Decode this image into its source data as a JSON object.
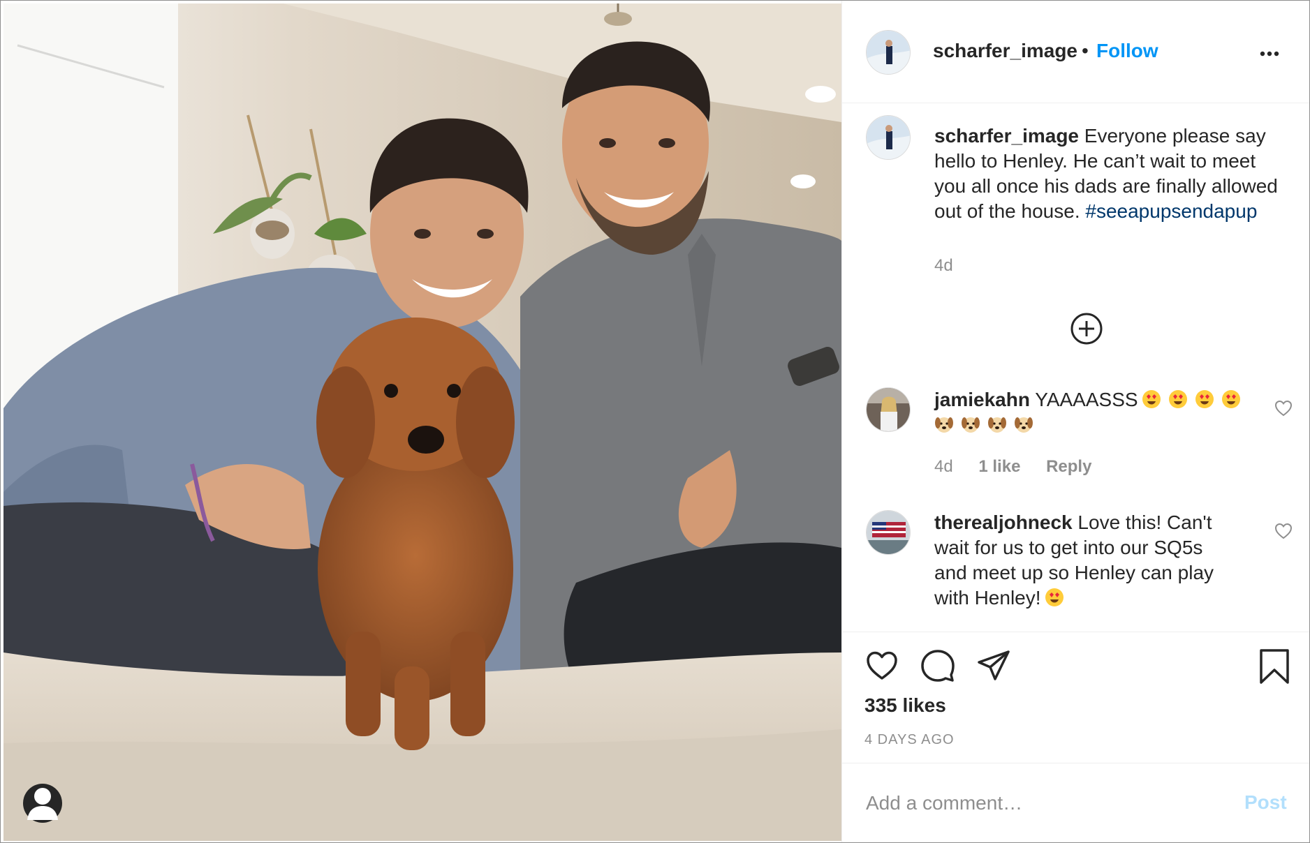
{
  "post": {
    "author": "scharfer_image",
    "follow_label": "Follow",
    "dot": "•"
  },
  "caption": {
    "username": "scharfer_image",
    "lines": [
      "Everyone please say",
      "hello to Henley. He can’t wait to meet",
      "you all once his dads are finally allowed",
      "out of the house."
    ],
    "hashtag": "#seeapupsendapup",
    "time": "4d"
  },
  "comments": [
    {
      "username": "jamiekahn",
      "text": "YAAAASSS",
      "emojis_line1": [
        "heart-eyes-emoji",
        "heart-eyes-emoji",
        "heart-eyes-emoji",
        "heart-eyes-emoji"
      ],
      "emojis_line2": [
        "dog-face-emoji",
        "dog-face-emoji",
        "dog-face-emoji",
        "dog-face-emoji"
      ],
      "time": "4d",
      "likes": "1 like",
      "reply": "Reply"
    },
    {
      "username": "therealjohneck",
      "lines": [
        "Love this! Can't",
        "wait for us to get into our SQ5s",
        "and meet up so Henley can play",
        "with Henley!"
      ],
      "emoji": "heart-eyes-emoji"
    }
  ],
  "likes": "335 likes",
  "time_ago": "4 DAYS AGO",
  "add_comment": {
    "placeholder": "Add a comment…",
    "post_label": "Post"
  },
  "icons": {
    "more": "more-options-icon",
    "load_more": "plus-circle-icon",
    "like": "heart-icon",
    "comment": "comment-icon",
    "share": "paper-plane-icon",
    "save": "bookmark-icon",
    "tag": "user-tag-icon"
  },
  "colors": {
    "link_blue": "#0095f6",
    "hashtag": "#00376b",
    "muted": "#8e8e8e",
    "text": "#262626",
    "post_disabled": "#b2dffc"
  }
}
